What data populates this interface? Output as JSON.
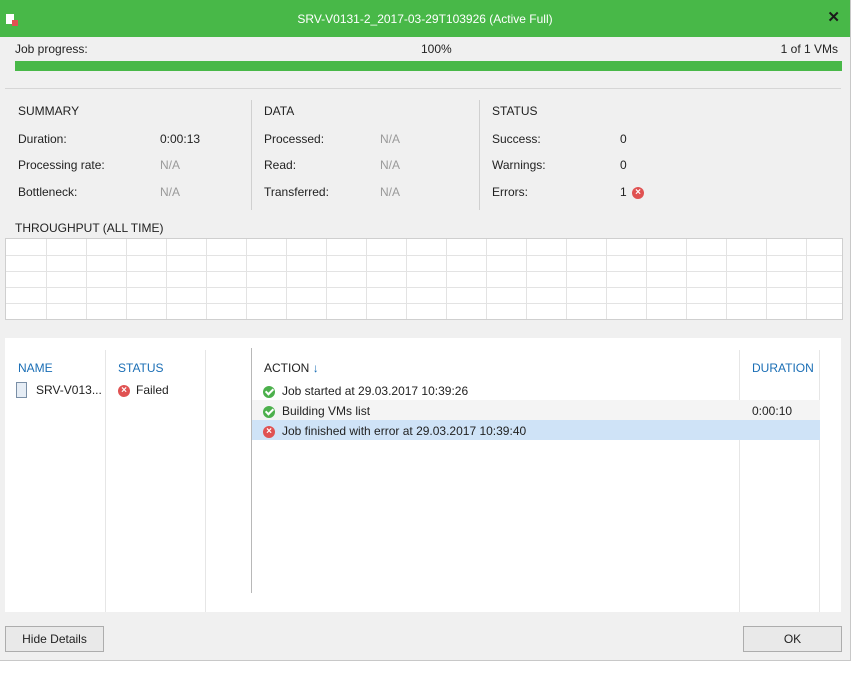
{
  "window": {
    "title": "SRV-V0131-2_2017-03-29T103926 (Active Full)",
    "close_glyph": "✕"
  },
  "progress": {
    "label": "Job progress:",
    "percent_text": "100%",
    "vms_text": "1 of 1 VMs",
    "fraction": 1.0
  },
  "summary": {
    "header": "SUMMARY",
    "rows": [
      {
        "label": "Duration:",
        "value": "0:00:13"
      },
      {
        "label": "Processing rate:",
        "value": "N/A"
      },
      {
        "label": "Bottleneck:",
        "value": "N/A"
      }
    ]
  },
  "data_section": {
    "header": "DATA",
    "rows": [
      {
        "label": "Processed:",
        "value": "N/A"
      },
      {
        "label": "Read:",
        "value": "N/A"
      },
      {
        "label": "Transferred:",
        "value": "N/A"
      }
    ]
  },
  "status_section": {
    "header": "STATUS",
    "rows": [
      {
        "label": "Success:",
        "value": "0"
      },
      {
        "label": "Warnings:",
        "value": "0"
      },
      {
        "label": "Errors:",
        "value": "1"
      }
    ]
  },
  "throughput": {
    "header": "THROUGHPUT (ALL TIME)"
  },
  "vm_table": {
    "headers": {
      "name": "NAME",
      "status": "STATUS"
    },
    "rows": [
      {
        "name": "SRV-V013...",
        "status": "Failed",
        "status_icon": "error-icon"
      }
    ]
  },
  "action_table": {
    "headers": {
      "action": "ACTION",
      "sort_glyph": "↓",
      "duration": "DURATION"
    },
    "rows": [
      {
        "icon": "success-icon",
        "action": "Job started at 29.03.2017 10:39:26",
        "duration": ""
      },
      {
        "icon": "success-icon",
        "action": "Building VMs list",
        "duration": "0:00:10"
      },
      {
        "icon": "error-icon",
        "action": "Job finished with error at 29.03.2017 10:39:40",
        "duration": "",
        "selected": true
      }
    ]
  },
  "buttons": {
    "hide_details": "Hide Details",
    "ok": "OK"
  },
  "colors": {
    "titlebar": "#48b848",
    "progress": "#48b848",
    "header_link": "#1a6eb5",
    "error": "#e05252",
    "success": "#4cb04c",
    "selected_row": "#cfe3f7"
  }
}
